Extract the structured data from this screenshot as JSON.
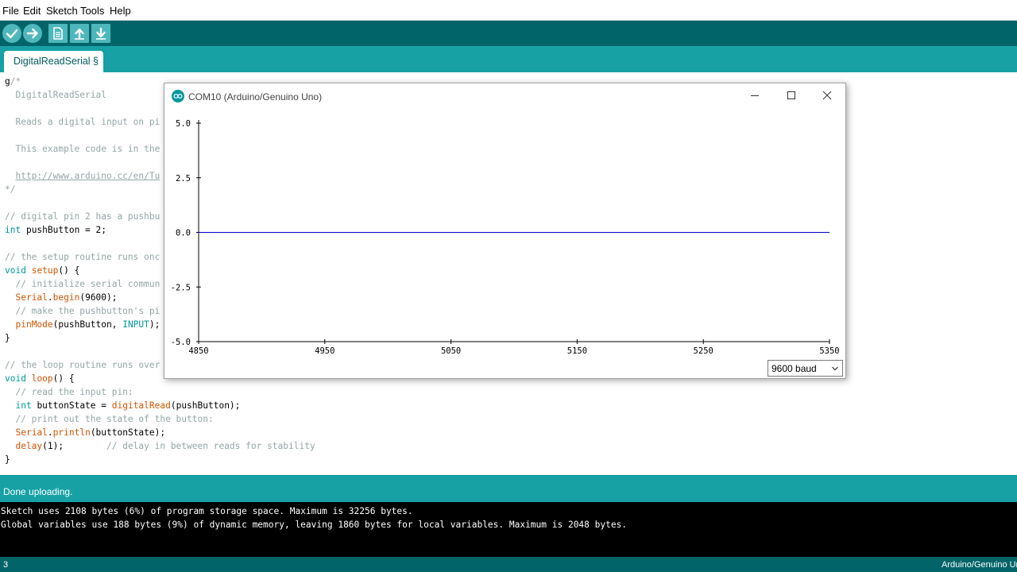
{
  "menu": {
    "items": [
      "File",
      "Edit",
      "Sketch",
      "Tools",
      "Help"
    ]
  },
  "toolbar": {
    "buttons": [
      {
        "name": "verify",
        "icon": "checkmark-icon"
      },
      {
        "name": "upload",
        "icon": "arrow-right-icon"
      },
      {
        "name": "new",
        "icon": "new-file-icon"
      },
      {
        "name": "open",
        "icon": "arrow-up-icon"
      },
      {
        "name": "save",
        "icon": "arrow-down-icon"
      }
    ]
  },
  "tab": {
    "label": "DigitalReadSerial §"
  },
  "editor": {
    "lines": [
      [
        {
          "t": "g",
          "c": "c-plain"
        },
        {
          "t": "/*",
          "c": "c-comment"
        }
      ],
      [
        {
          "t": "  DigitalReadSerial",
          "c": "c-comment"
        }
      ],
      [],
      [
        {
          "t": "  Reads a digital input on pi",
          "c": "c-comment"
        }
      ],
      [],
      [
        {
          "t": "  This example code is in the",
          "c": "c-comment"
        }
      ],
      [],
      [
        {
          "t": "  ",
          "c": "c-comment"
        },
        {
          "t": "http://www.arduino.cc/en/Tu",
          "c": "c-linkish"
        }
      ],
      [
        {
          "t": "*/",
          "c": "c-comment"
        }
      ],
      [],
      [
        {
          "t": "// digital pin 2 has a pushbu",
          "c": "c-comment"
        }
      ],
      [
        {
          "t": "int",
          "c": "c-keyword"
        },
        {
          "t": " pushButton = 2;",
          "c": "c-plain"
        }
      ],
      [],
      [
        {
          "t": "// the setup routine runs onc",
          "c": "c-comment"
        }
      ],
      [
        {
          "t": "void",
          "c": "c-keyword"
        },
        {
          "t": " ",
          "c": "c-plain"
        },
        {
          "t": "setup",
          "c": "c-func"
        },
        {
          "t": "() {",
          "c": "c-plain"
        }
      ],
      [
        {
          "t": "  // initialize serial commun",
          "c": "c-comment"
        }
      ],
      [
        {
          "t": "  ",
          "c": "c-plain"
        },
        {
          "t": "Serial",
          "c": "c-func"
        },
        {
          "t": ".",
          "c": "c-plain"
        },
        {
          "t": "begin",
          "c": "c-func"
        },
        {
          "t": "(9600);",
          "c": "c-plain"
        }
      ],
      [
        {
          "t": "  // make the pushbutton's pi",
          "c": "c-comment"
        }
      ],
      [
        {
          "t": "  ",
          "c": "c-plain"
        },
        {
          "t": "pinMode",
          "c": "c-func"
        },
        {
          "t": "(pushButton, ",
          "c": "c-plain"
        },
        {
          "t": "INPUT",
          "c": "c-keyword"
        },
        {
          "t": ");",
          "c": "c-plain"
        }
      ],
      [
        {
          "t": "}",
          "c": "c-plain"
        }
      ],
      [],
      [
        {
          "t": "// the loop routine runs over",
          "c": "c-comment"
        }
      ],
      [
        {
          "t": "void",
          "c": "c-keyword"
        },
        {
          "t": " ",
          "c": "c-plain"
        },
        {
          "t": "loop",
          "c": "c-func"
        },
        {
          "t": "() {",
          "c": "c-plain"
        }
      ],
      [
        {
          "t": "  // read the input pin:",
          "c": "c-comment"
        }
      ],
      [
        {
          "t": "  ",
          "c": "c-plain"
        },
        {
          "t": "int",
          "c": "c-keyword"
        },
        {
          "t": " buttonState = ",
          "c": "c-plain"
        },
        {
          "t": "digitalRead",
          "c": "c-func"
        },
        {
          "t": "(pushButton);",
          "c": "c-plain"
        }
      ],
      [
        {
          "t": "  // print out the state of the button:",
          "c": "c-comment"
        }
      ],
      [
        {
          "t": "  ",
          "c": "c-plain"
        },
        {
          "t": "Serial",
          "c": "c-func"
        },
        {
          "t": ".",
          "c": "c-plain"
        },
        {
          "t": "println",
          "c": "c-func"
        },
        {
          "t": "(buttonState);",
          "c": "c-plain"
        }
      ],
      [
        {
          "t": "  ",
          "c": "c-plain"
        },
        {
          "t": "delay",
          "c": "c-func"
        },
        {
          "t": "(1);        ",
          "c": "c-plain"
        },
        {
          "t": "// delay in between reads for stability",
          "c": "c-comment"
        }
      ],
      [
        {
          "t": "}",
          "c": "c-plain"
        }
      ]
    ]
  },
  "status": {
    "message": "Done uploading."
  },
  "console": {
    "lines": [
      "Sketch uses 2108 bytes (6%) of program storage space. Maximum is 32256 bytes.",
      "Global variables use 188 bytes (9%) of dynamic memory, leaving 1860 bytes for local variables. Maximum is 2048 bytes."
    ]
  },
  "bottom": {
    "line_number": "3",
    "board": "Arduino/Genuino Uno"
  },
  "plotter": {
    "title": "COM10 (Arduino/Genuino Uno)",
    "baud": "9600 baud",
    "controls": [
      "minimize-icon",
      "maximize-icon",
      "close-icon"
    ]
  },
  "chart_data": {
    "type": "line",
    "title": "",
    "xlabel": "",
    "ylabel": "",
    "xlim": [
      4850,
      5350
    ],
    "ylim": [
      -5.0,
      5.0
    ],
    "x_ticks": [
      4850,
      4950,
      5050,
      5150,
      5250,
      5350
    ],
    "y_ticks": [
      5.0,
      2.5,
      0.0,
      -2.5,
      -5.0
    ],
    "y_tick_labels": [
      "5.0",
      "2.5",
      "0.0",
      "-2.5",
      "-5.0"
    ],
    "grid": false,
    "series": [
      {
        "color": "#0000c8",
        "x": [
          4850,
          5350
        ],
        "y": [
          0,
          0
        ]
      }
    ]
  },
  "colors": {
    "teal_dark": "#006468",
    "teal": "#17a1a5",
    "series": "#0000c8"
  }
}
